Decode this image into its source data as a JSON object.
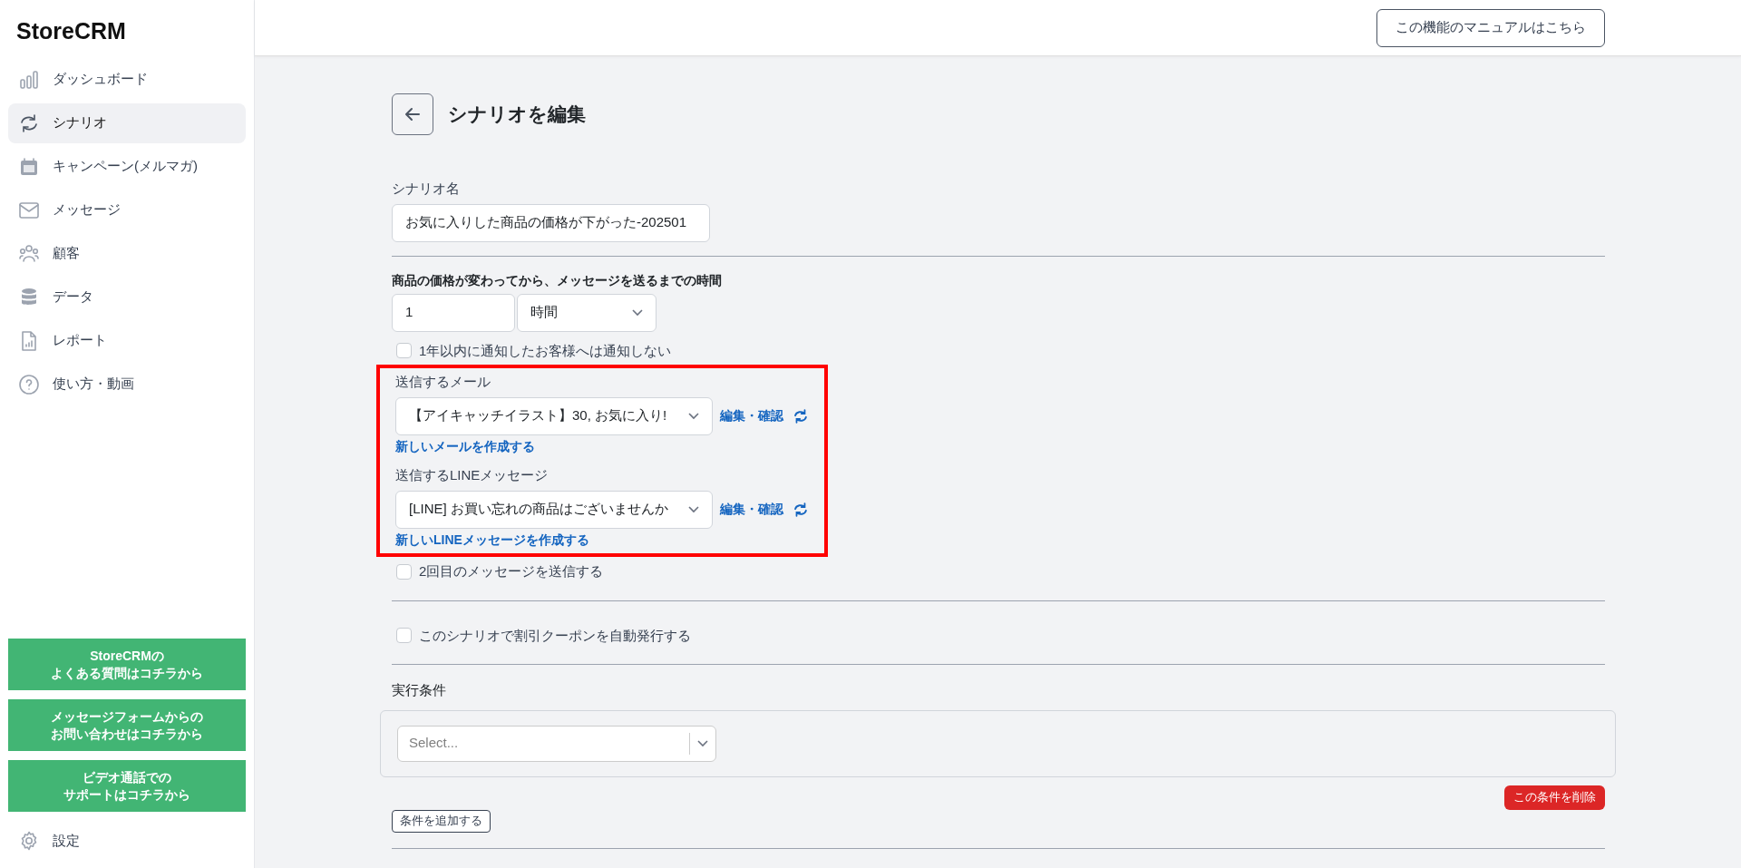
{
  "brand": "StoreCRM",
  "nav": [
    {
      "label": "ダッシュボード",
      "kind": "bars",
      "selected": false
    },
    {
      "label": "シナリオ",
      "kind": "cycle",
      "selected": true
    },
    {
      "label": "キャンペーン(メルマガ)",
      "kind": "calendar",
      "selected": false
    },
    {
      "label": "メッセージ",
      "kind": "mail",
      "selected": false
    },
    {
      "label": "顧客",
      "kind": "people",
      "selected": false
    },
    {
      "label": "データ",
      "kind": "database",
      "selected": false
    },
    {
      "label": "レポート",
      "kind": "report",
      "selected": false
    },
    {
      "label": "使い方・動画",
      "kind": "help",
      "selected": false
    }
  ],
  "support_buttons": [
    {
      "lines": [
        "StoreCRMの",
        "よくある質問はコチラから"
      ]
    },
    {
      "lines": [
        "メッセージフォームからの",
        "お問い合わせはコチラから"
      ]
    },
    {
      "lines": [
        "ビデオ通話での",
        "サポートはコチラから"
      ]
    }
  ],
  "settings": {
    "label": "設定"
  },
  "header": {
    "manual_button": "この機能のマニュアルはこちら"
  },
  "page": {
    "title": "シナリオを編集"
  },
  "scenario_name": {
    "label": "シナリオ名",
    "value": "お気に入りした商品の価格が下がった-202501"
  },
  "delay": {
    "label": "商品の価格が変わってから、メッセージを送るまでの時間",
    "amount": "1",
    "unit": "時間"
  },
  "checks_top": [
    {
      "label": "1年以内に通知したお客様へは通知しない",
      "checked": false
    }
  ],
  "messages": {
    "highlighted": true,
    "items": [
      {
        "label": "送信するメール",
        "value": "【アイキャッチイラスト】30, お気に入り!",
        "edit_link": "編集・確認",
        "create_link": "新しいメールを作成する"
      },
      {
        "label": "送信するLINEメッセージ",
        "value": "[LINE] お買い忘れの商品はございませんか",
        "edit_link": "編集・確認",
        "create_link": "新しいLINEメッセージを作成する"
      }
    ]
  },
  "second_message": {
    "label": "2回目のメッセージを送信する",
    "checked": false
  },
  "coupon": {
    "label": "このシナリオで割引クーポンを自動発行する",
    "checked": false
  },
  "conditions": {
    "label": "実行条件",
    "select_placeholder": "Select...",
    "delete_button": "この条件を削除",
    "add_button": "条件を追加する"
  }
}
